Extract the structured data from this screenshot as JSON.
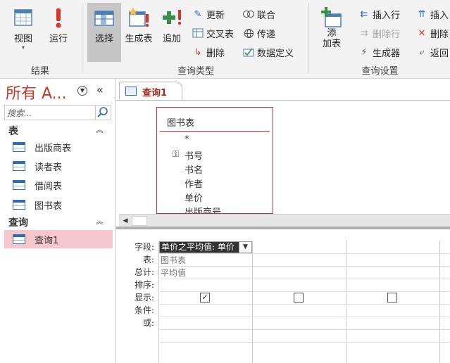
{
  "ribbon": {
    "results_group": {
      "label": "结果",
      "view_label": "视图",
      "run_label": "运行"
    },
    "query_type_group": {
      "label": "查询类型",
      "select_label": "选择",
      "make_table_label": "生成表",
      "append_label": "追加",
      "update_label": "更新",
      "crosstab_label": "交叉表",
      "delete_label": "删除",
      "union_label": "联合",
      "passthrough_label": "传递",
      "data_definition_label": "数据定义"
    },
    "query_setup_group": {
      "label": "查询设置",
      "add_table_label": "添\n加表",
      "insert_row_label": "插入行",
      "delete_row_label": "删除行",
      "builder_label": "生成器",
      "insert_col_label": "插入",
      "delete_col_label": "删除",
      "return_label": "返回"
    }
  },
  "nav": {
    "title": "所有 A...",
    "search_placeholder": "搜索...",
    "sections": [
      {
        "title": "表",
        "items": [
          "出版商表",
          "读者表",
          "借阅表",
          "图书表"
        ]
      },
      {
        "title": "查询",
        "items": [
          "查询1"
        ]
      }
    ]
  },
  "document": {
    "tab_label": "查询1",
    "table": {
      "title": "图书表",
      "fields": [
        "*",
        "书号",
        "书名",
        "作者",
        "单价",
        "出版商号"
      ]
    },
    "grid": {
      "row_labels": [
        "字段:",
        "表:",
        "总计:",
        "排序:",
        "显示:",
        "条件:",
        "或:"
      ],
      "columns": [
        {
          "field": "单价之平均值: 单价",
          "table": "图书表",
          "total": "平均值",
          "show": true
        },
        {
          "field": "",
          "table": "",
          "total": "",
          "show": false
        },
        {
          "field": "",
          "table": "",
          "total": "",
          "show": false
        }
      ]
    }
  },
  "colors": {
    "accent": "#c0392b",
    "selected_nav": "#f5c6cc",
    "ribbon_bg": "#f3f3f3"
  }
}
